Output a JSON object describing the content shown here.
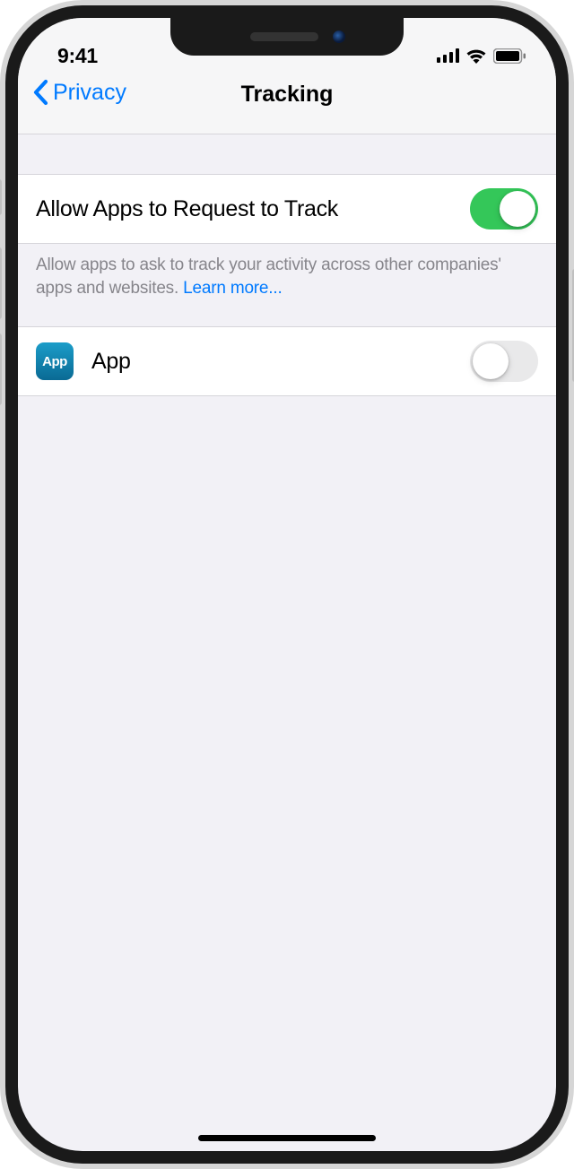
{
  "status": {
    "time": "9:41"
  },
  "nav": {
    "back_label": "Privacy",
    "title": "Tracking"
  },
  "rows": {
    "allow_label": "Allow Apps to Request to Track",
    "allow_toggle_on": true
  },
  "footer": {
    "text": "Allow apps to ask to track your activity across other companies' apps and websites. ",
    "link": "Learn more..."
  },
  "apps": [
    {
      "name": "App",
      "icon_text": "App",
      "toggle_on": false
    }
  ]
}
